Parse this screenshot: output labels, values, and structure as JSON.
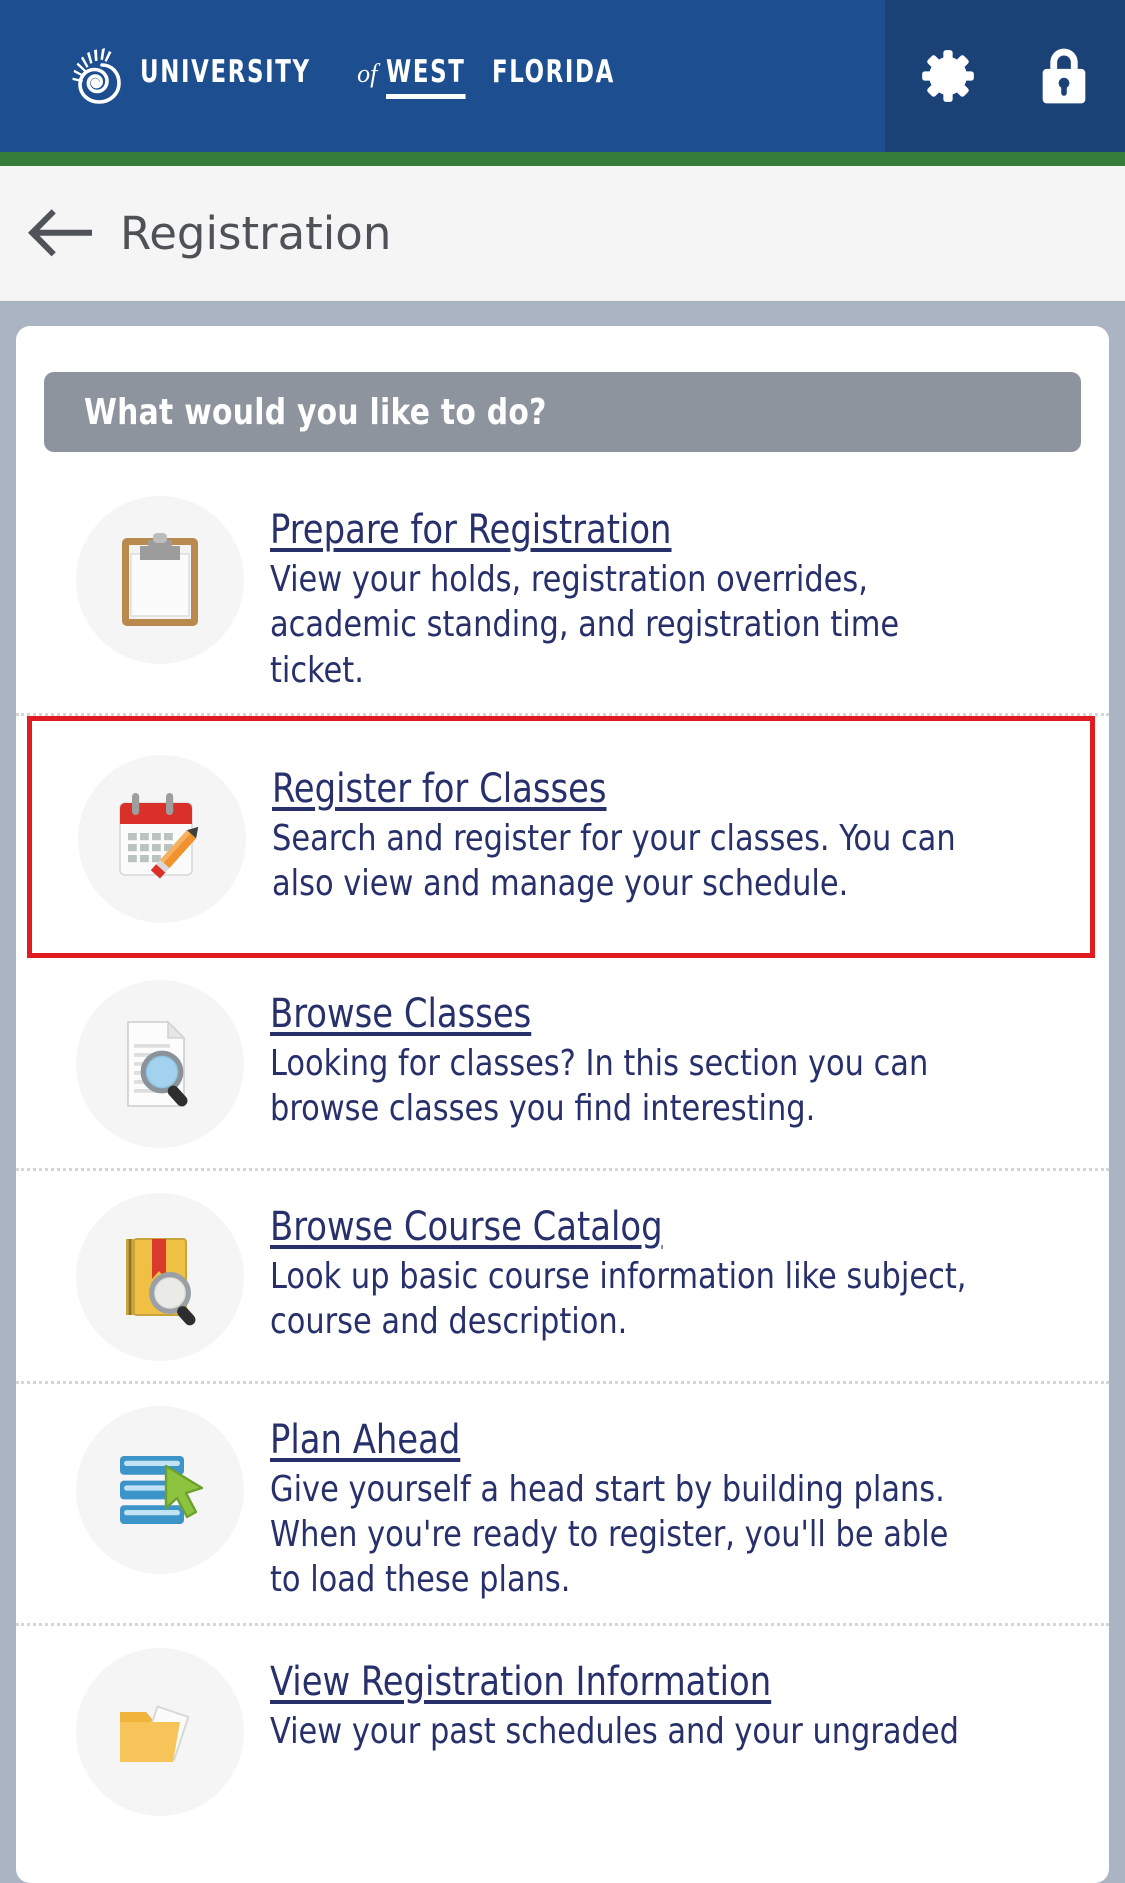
{
  "header": {
    "logo": {
      "icon": "nautilus-shell-logo",
      "university": "UNIVERSITY",
      "of": "of",
      "west": "WEST",
      "florida": "FLORIDA"
    },
    "actions": [
      {
        "icon": "gear-icon",
        "name": "settings-button"
      },
      {
        "icon": "lock-icon",
        "name": "sign-out-button"
      }
    ],
    "brand_blue": "#1d4f90",
    "brand_blue_dark": "#1b4277",
    "accent_green": "#367c3a"
  },
  "pagehead": {
    "back_icon": "back-arrow-icon",
    "title": "Registration"
  },
  "banner": {
    "text": "What would you like to do?",
    "background": "#8d949e"
  },
  "options": [
    {
      "icon": "clipboard-icon",
      "title": "Prepare for Registration",
      "description": "View your holds, registration overrides, academic standing, and registration time ticket.",
      "highlighted": false
    },
    {
      "icon": "calendar-pencil-icon",
      "title": "Register for Classes",
      "description": "Search and register for your classes. You can also view and manage your schedule.",
      "highlighted": true
    },
    {
      "icon": "document-search-icon",
      "title": "Browse Classes",
      "description": "Looking for classes? In this section you can browse classes you find interesting.",
      "highlighted": false
    },
    {
      "icon": "book-search-icon",
      "title": "Browse Course Catalog",
      "description": "Look up basic course information like subject, course and description.",
      "highlighted": false
    },
    {
      "icon": "plan-bars-cursor-icon",
      "title": "Plan Ahead",
      "description": "Give yourself a head start by building plans. When you're ready to register, you'll be able to load these plans.",
      "highlighted": false
    },
    {
      "icon": "folder-document-icon",
      "title": "View Registration Information",
      "description": "View your past schedules and your ungraded",
      "highlighted": false
    }
  ],
  "highlight_color": "#e01b22",
  "link_color": "#27306b",
  "page_background": "#aab4c2"
}
